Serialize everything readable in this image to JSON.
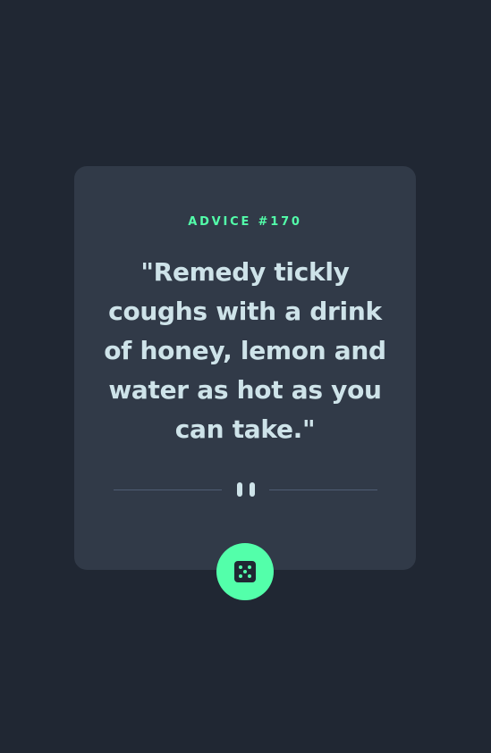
{
  "advice": {
    "heading": "ADVICE #170",
    "quote": "\"Remedy tickly coughs with a drink of honey, lemon and water as hot as you can take.\""
  },
  "icons": {
    "divider": "pause-icon",
    "button": "dice-icon"
  },
  "colors": {
    "background": "#202733",
    "card": "#313a48",
    "accent": "#53ffaa",
    "text": "#cee3e9",
    "divider": "#4f5d74"
  }
}
